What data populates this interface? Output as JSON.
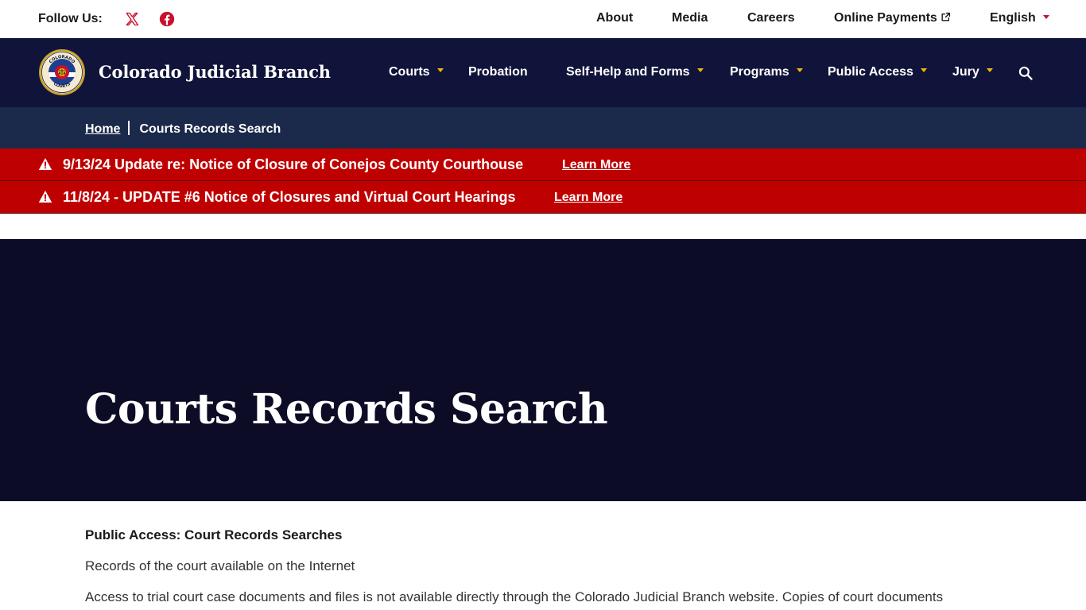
{
  "utility": {
    "follow_label": "Follow Us:",
    "social": [
      {
        "name": "x-icon"
      },
      {
        "name": "facebook-icon"
      }
    ],
    "links": {
      "about": "About",
      "media": "Media",
      "careers": "Careers",
      "payments": "Online Payments",
      "language": "English"
    }
  },
  "header": {
    "brand": "Colorado Judicial Branch",
    "logo_text_top": "COLORADO",
    "logo_text_bottom": "COURTS",
    "nav": {
      "courts": "Courts",
      "probation": "Probation",
      "self_help": "Self-Help and Forms",
      "programs": "Programs",
      "public_access": "Public Access",
      "jury": "Jury"
    }
  },
  "breadcrumb": {
    "home": "Home",
    "current": "Courts Records Search"
  },
  "alerts": [
    {
      "text": "9/13/24 Update re: Notice of Closure of Conejos County Courthouse",
      "link": "Learn More"
    },
    {
      "text": "11/8/24 - UPDATE #6 Notice of Closures and Virtual Court Hearings",
      "link": "Learn More"
    }
  ],
  "hero": {
    "title": "Courts Records Search"
  },
  "content": {
    "heading": "Public Access: Court Records Searches",
    "para1": "Records of the court available on the Internet",
    "para2": "Access to trial court case documents and files is not available directly through the Colorado Judicial Branch website. Copies of court documents"
  },
  "colors": {
    "nav_bg": "#10143a",
    "breadcrumb_bg": "#1b2a4a",
    "alert_bg": "#bf0000",
    "hero_bg": "#0c0c26",
    "accent_red": "#c8102e",
    "accent_gold": "#f2b705"
  }
}
